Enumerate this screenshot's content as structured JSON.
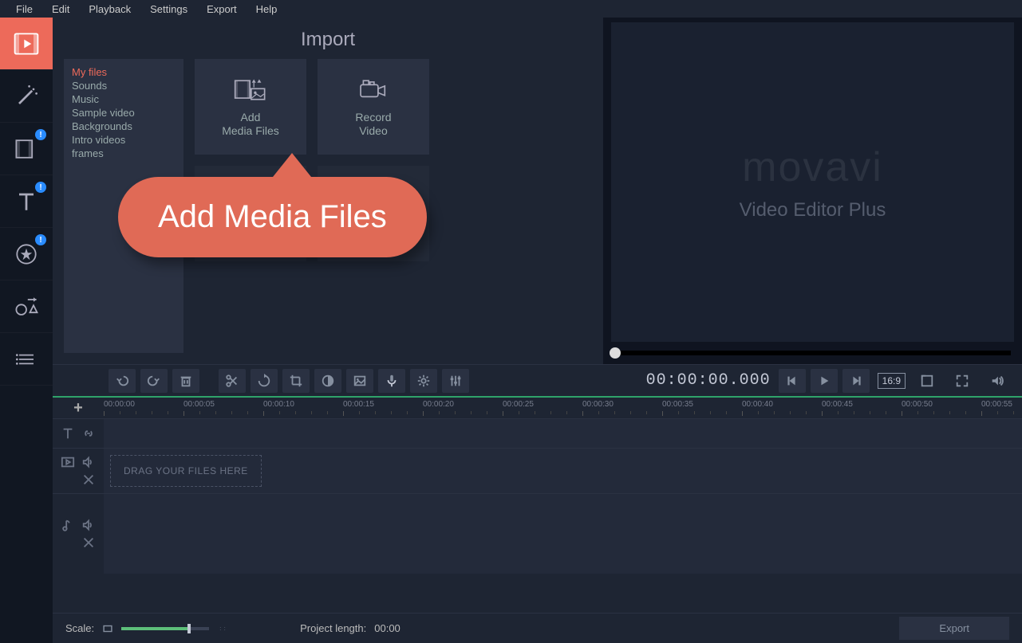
{
  "menu": {
    "items": [
      "File",
      "Edit",
      "Playback",
      "Settings",
      "Export",
      "Help"
    ]
  },
  "leftTools": [
    {
      "name": "import-tool",
      "active": true,
      "badge": false
    },
    {
      "name": "magic-tool",
      "active": false,
      "badge": false
    },
    {
      "name": "filters-tool",
      "active": false,
      "badge": true
    },
    {
      "name": "titles-tool",
      "active": false,
      "badge": true
    },
    {
      "name": "stickers-tool",
      "active": false,
      "badge": true
    },
    {
      "name": "shapes-tool",
      "active": false,
      "badge": false
    },
    {
      "name": "more-tool",
      "active": false,
      "badge": false
    }
  ],
  "import": {
    "title": "Import",
    "sidebar": [
      "My files",
      "Sounds",
      "Music",
      "Sample video",
      "Backgrounds",
      "Intro videos",
      "frames"
    ],
    "sidebarActive": 0,
    "tiles": [
      {
        "name": "add-media",
        "label1": "Add",
        "label2": "Media Files"
      },
      {
        "name": "record-video",
        "label1": "Record",
        "label2": "Video"
      }
    ]
  },
  "callout": "Add Media Files",
  "brand": {
    "logo": "movavi",
    "sub": "Video Editor Plus"
  },
  "timecode": "00:00:00.000",
  "aspect": "16:9",
  "ruler": {
    "labels": [
      "00:00:00",
      "00:00:05",
      "00:00:10",
      "00:00:15",
      "00:00:20",
      "00:00:25",
      "00:00:30",
      "00:00:35",
      "00:00:40",
      "00:00:45",
      "00:00:50",
      "00:00:55"
    ]
  },
  "dragHint": "DRAG YOUR FILES HERE",
  "footer": {
    "scaleLabel": "Scale:",
    "projectLengthLabel": "Project length:",
    "projectLength": "00:00",
    "exportLabel": "Export"
  },
  "toolbar": {
    "buttons": [
      "undo",
      "redo",
      "delete",
      "cut",
      "rotate",
      "crop",
      "color",
      "image",
      "mic",
      "gear",
      "levels"
    ],
    "play": [
      "prev",
      "play",
      "next"
    ],
    "right": [
      "project-size",
      "fullscreen",
      "volume"
    ]
  }
}
